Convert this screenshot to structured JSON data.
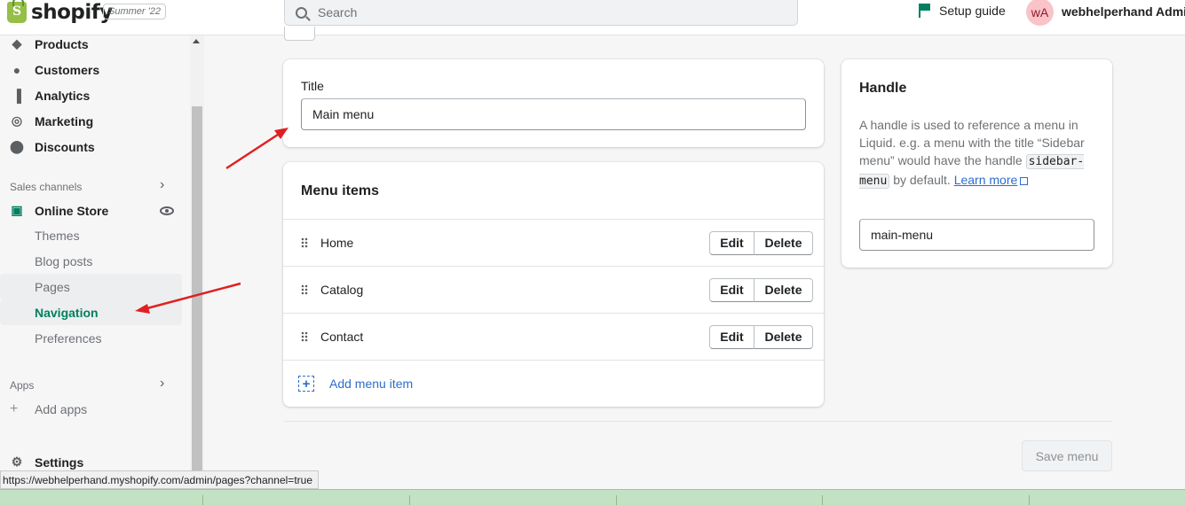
{
  "topbar": {
    "logo_text": "shopify",
    "edition": "Summer '22",
    "search_placeholder": "Search",
    "setup_guide": "Setup guide",
    "avatar_initials": "wA",
    "username": "webhelperhand Admin"
  },
  "sidebar": {
    "items": [
      {
        "label": "Products",
        "icon": "tag-icon"
      },
      {
        "label": "Customers",
        "icon": "person-icon"
      },
      {
        "label": "Analytics",
        "icon": "bar-chart-icon"
      },
      {
        "label": "Marketing",
        "icon": "target-icon"
      },
      {
        "label": "Discounts",
        "icon": "discount-icon"
      }
    ],
    "sales_channels_label": "Sales channels",
    "online_store": "Online Store",
    "store_subitems": [
      "Themes",
      "Blog posts",
      "Pages",
      "Navigation",
      "Preferences"
    ],
    "apps_label": "Apps",
    "add_apps": "Add apps",
    "settings": "Settings"
  },
  "title_card": {
    "label": "Title",
    "value": "Main menu"
  },
  "menu_card": {
    "heading": "Menu items",
    "items": [
      "Home",
      "Catalog",
      "Contact"
    ],
    "edit_label": "Edit",
    "delete_label": "Delete",
    "add_label": "Add menu item"
  },
  "handle_card": {
    "heading": "Handle",
    "desc_part1": "A handle is used to reference a menu in Liquid. e.g. a menu with the title “Sidebar menu” would have the handle",
    "code": "sidebar-menu",
    "desc_part2": "by default.",
    "learn_more": "Learn more",
    "value": "main-menu"
  },
  "save_button": "Save menu",
  "status_url": "https://webhelperhand.myshopify.com/admin/pages?channel=true",
  "colors": {
    "accent": "#008060",
    "link": "#2c6ecb",
    "annotation": "#e02020"
  }
}
